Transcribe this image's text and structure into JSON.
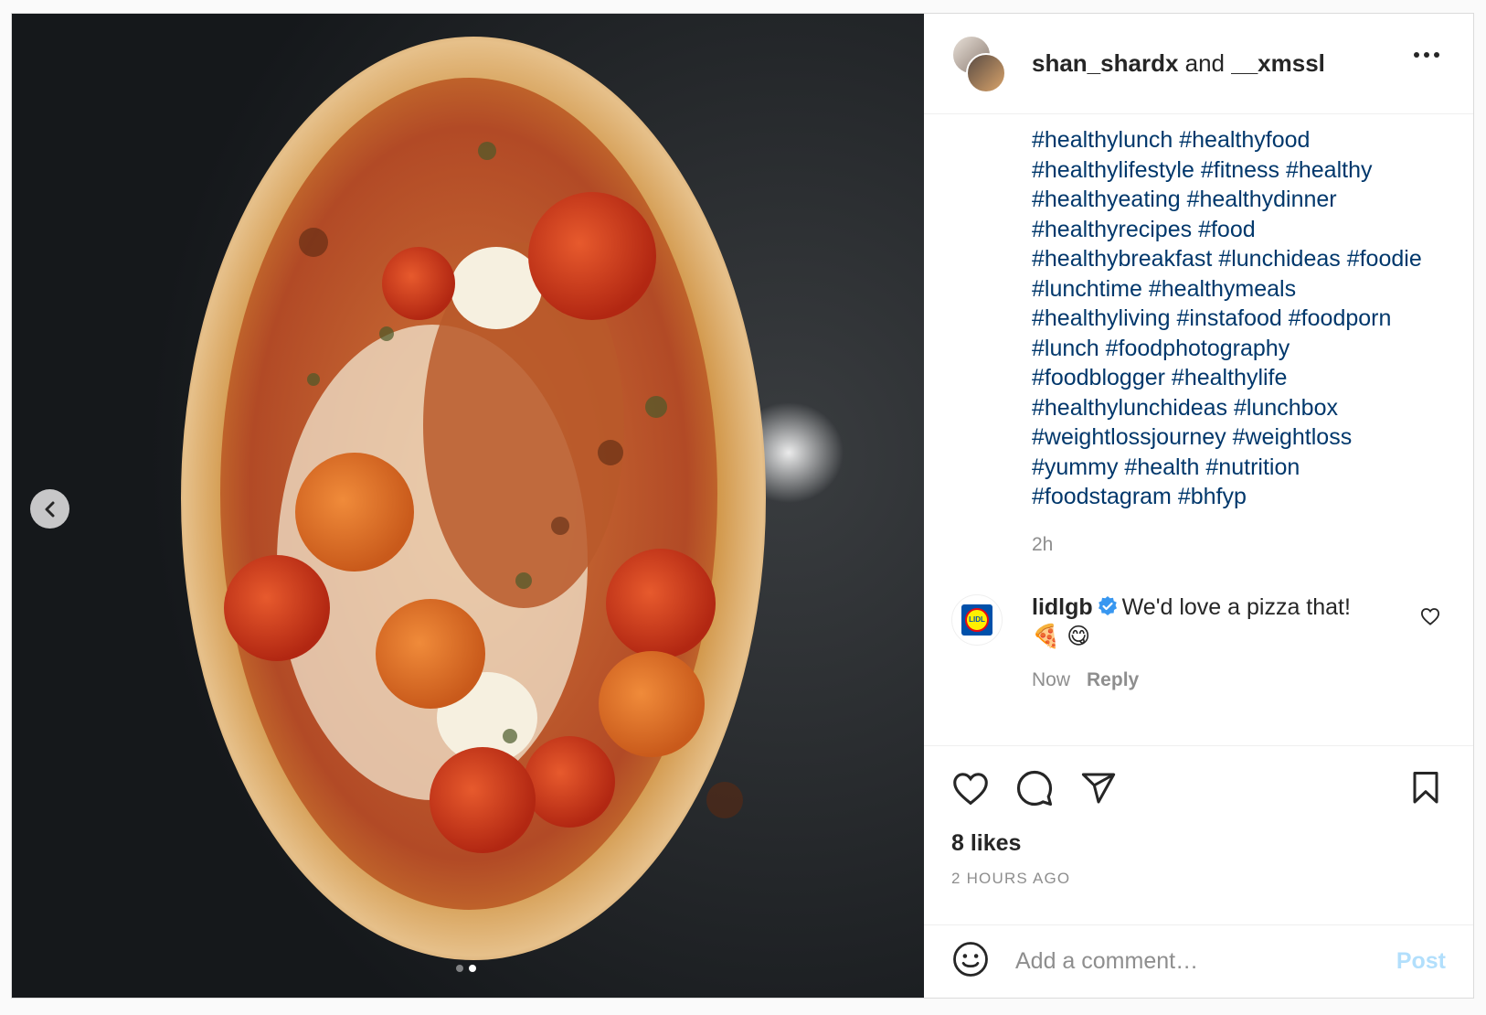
{
  "post": {
    "owner": "shan_shardx",
    "conjunction": "and",
    "collaborator": "__xmssl",
    "hashtags": [
      "#healthylunch",
      "#healthyfood",
      "#healthylifestyle",
      "#fitness",
      "#healthy",
      "#healthyeating",
      "#healthydinner",
      "#healthyrecipes",
      "#food",
      "#healthybreakfast",
      "#lunchideas",
      "#foodie",
      "#lunchtime",
      "#healthymeals",
      "#healthyliving",
      "#instafood",
      "#foodporn",
      "#lunch",
      "#foodphotography",
      "#foodblogger",
      "#healthylife",
      "#healthylunchideas",
      "#lunchbox",
      "#weightlossjourney",
      "#weightloss",
      "#yummy",
      "#health",
      "#nutrition",
      "#foodstagram",
      "#bhfyp"
    ],
    "caption_time": "2h",
    "likes": "8 likes",
    "posted_ago": "2 HOURS AGO",
    "carousel": {
      "total": 2,
      "current": 2
    }
  },
  "comments": [
    {
      "user": "lidlgb",
      "verified": true,
      "text": "We'd love a pizza that! 🍕 😋",
      "time": "Now",
      "reply_label": "Reply"
    }
  ],
  "add_comment": {
    "placeholder": "Add a comment…",
    "post_label": "Post"
  },
  "icons": {
    "more": "more-options-icon",
    "like": "heart-icon",
    "comment": "comment-icon",
    "share": "share-icon",
    "save": "bookmark-icon",
    "emoji": "emoji-icon",
    "prev": "chevron-left-icon",
    "verified": "verified-badge-icon"
  },
  "colors": {
    "hashtag": "#00376b",
    "post_button_disabled": "#b2dffc",
    "verified": "#3897f0",
    "muted": "#8e8e8e"
  }
}
